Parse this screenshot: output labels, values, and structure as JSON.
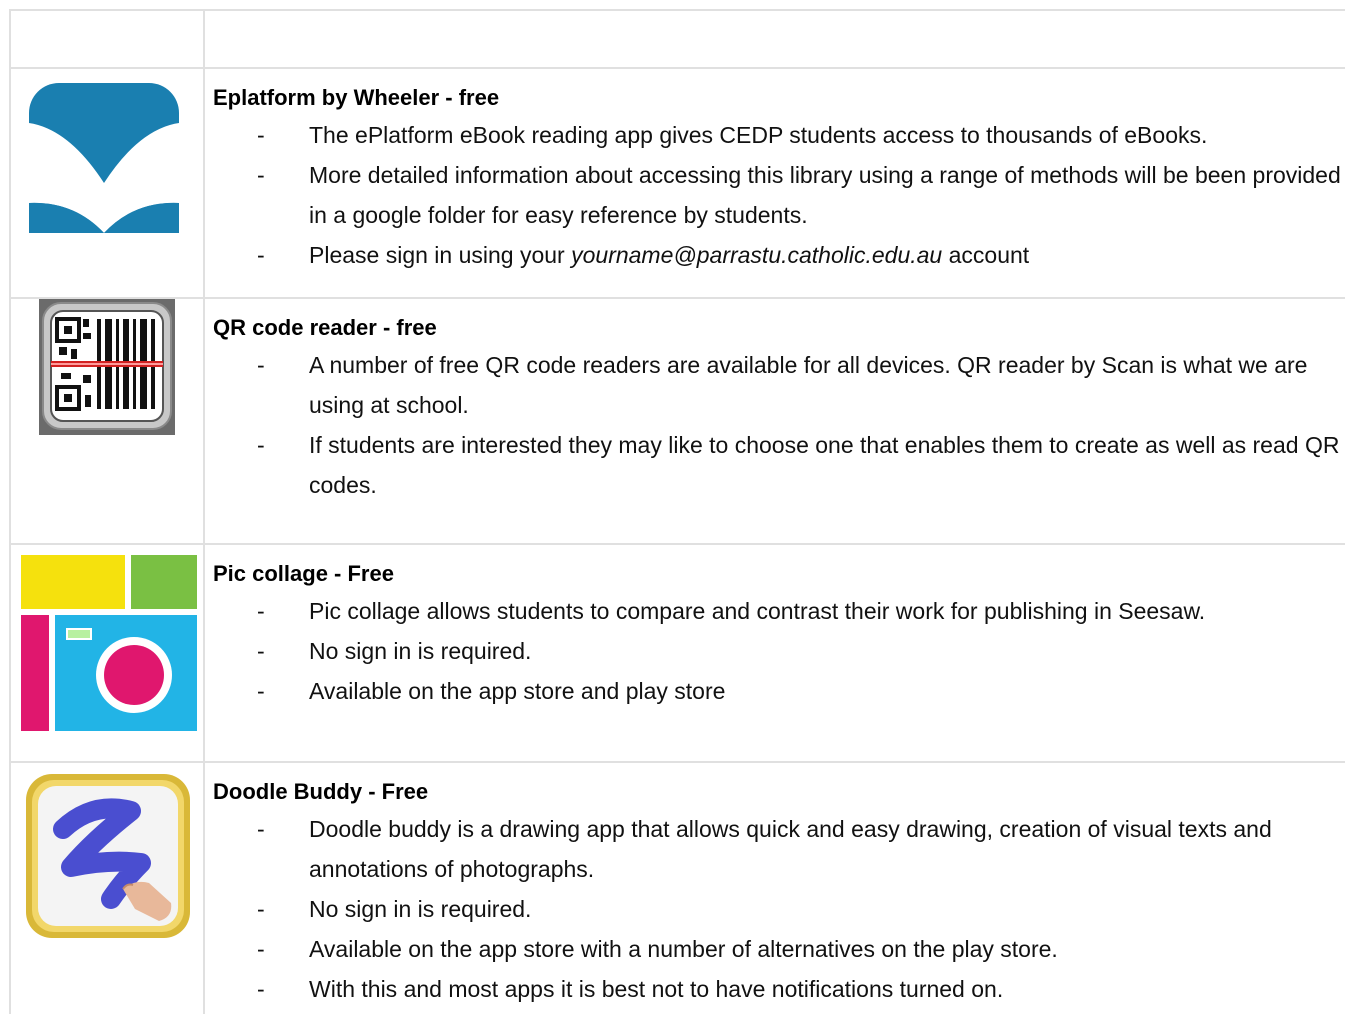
{
  "apps": [
    {
      "title": "Eplatform by Wheeler - free",
      "icon": "eplatform-book-icon",
      "bullets": [
        "The ePlatform eBook reading app gives CEDP students access to thousands of eBooks.",
        "More detailed information about accessing this library using a range of methods will be been provided in a google folder for easy reference by students."
      ],
      "signin": {
        "prefix": "Please sign in using your ",
        "email": "yourname@parrastu.catholic.edu.au",
        "suffix": " account"
      }
    },
    {
      "title": "QR code reader - free",
      "icon": "qr-scanner-icon",
      "bullets": [
        "A number of free QR code readers are available for all devices. QR reader by Scan is what we are using at school.",
        " If students are interested they may like to choose one that enables them to create as well as read QR codes."
      ]
    },
    {
      "title": "Pic collage - Free",
      "icon": "pic-collage-camera-icon",
      "bullets": [
        "Pic collage allows students to compare and contrast their work for publishing in Seesaw.",
        "No sign in is required.",
        "Available on the app store and play store"
      ]
    },
    {
      "title": "Doodle Buddy - Free",
      "icon": "doodle-buddy-icon",
      "bullets": [
        "Doodle buddy is a drawing app that allows quick and easy drawing, creation of visual texts and annotations of photographs.",
        "No sign in is required.",
        "Available on the app store with a number of alternatives on the play store.",
        "With this and most apps it is best not to have notifications turned on."
      ]
    }
  ],
  "dash": "-",
  "colors": {
    "grid": "#e0e0e0",
    "eplatform_blue": "#1a7fb0",
    "qr_red": "#d22020",
    "pic_pink": "#e0176e",
    "pic_cyan": "#22b4e6",
    "pic_yellow": "#f5e10d",
    "pic_green": "#7ac043",
    "doodle_purple": "#4a4ed0",
    "doodle_gold": "#d9b838"
  }
}
